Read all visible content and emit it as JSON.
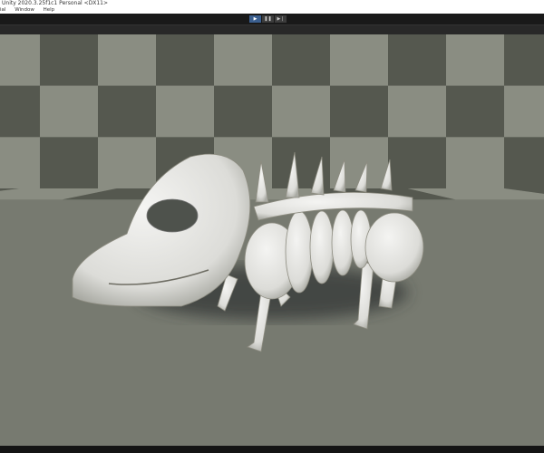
{
  "window": {
    "title": "Unity 2020.3.25f1c1 Personal <DX11>"
  },
  "menu": {
    "items": [
      "ial",
      "Window",
      "Help"
    ]
  },
  "toolbar": {
    "play_icon": "play-icon",
    "pause_icon": "pause-icon",
    "step_icon": "step-icon",
    "play_active": true,
    "accent": "#3b5f8f"
  },
  "scene": {
    "light_tile": "#8a8d82",
    "dark_tile": "#55584f",
    "subject": "bone-dinosaur-skeleton"
  }
}
